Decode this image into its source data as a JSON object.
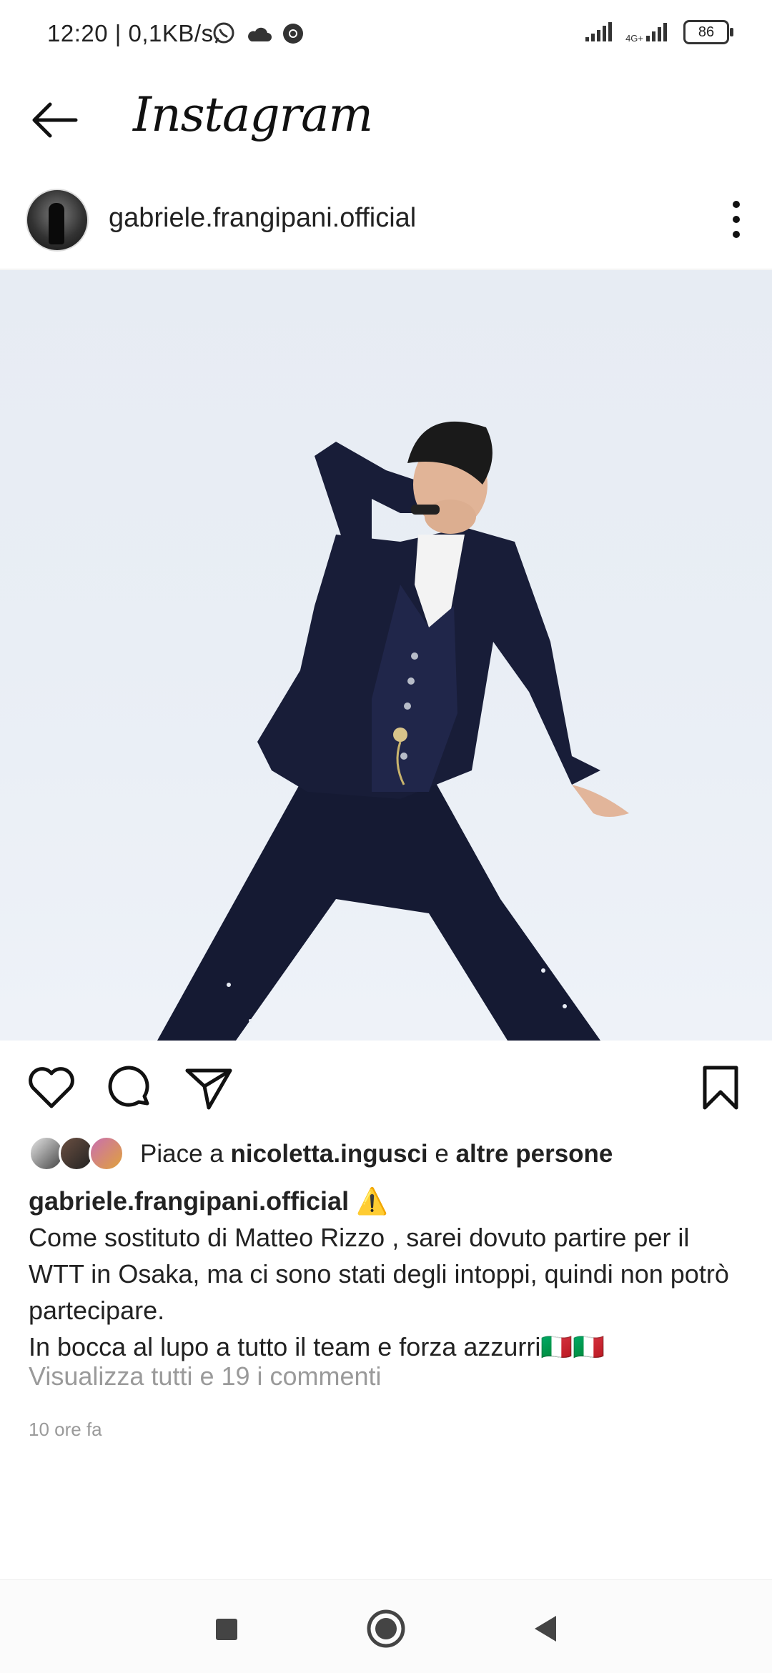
{
  "status_bar": {
    "time": "12:20",
    "speed": "| 0,1KB/s",
    "network_label": "4G+",
    "battery": "86"
  },
  "header": {
    "title": "Instagram",
    "back_icon": "arrow-left-icon"
  },
  "post": {
    "username": "gabriele.frangipani.official",
    "more_icon": "more-vertical-icon",
    "actions": {
      "like_icon": "heart-icon",
      "comment_icon": "comment-icon",
      "share_icon": "send-icon",
      "save_icon": "bookmark-icon"
    },
    "likes": {
      "prefix": "Piace a",
      "liker": "nicoletta.ingusci",
      "connector": "e",
      "others": "altre persone"
    },
    "caption": {
      "username": "gabriele.frangipani.official",
      "emoji": "⚠️",
      "text": "Come sostituto di Matteo Rizzo , sarei  dovuto partire per il WTT in Osaka, ma ci sono stati degli intoppi, quindi non potrò partecipare.",
      "text2": "In bocca al lupo a tutto il team e forza azzurri🇮🇹🇮🇹"
    },
    "comments_link": "Visualizza tutti e 19 i commenti",
    "time_ago": "10 ore fa"
  },
  "colors": {
    "text": "#222222",
    "muted": "#9a9a9a",
    "photo_bg": "#e9eef5",
    "suit": "#151a33"
  }
}
